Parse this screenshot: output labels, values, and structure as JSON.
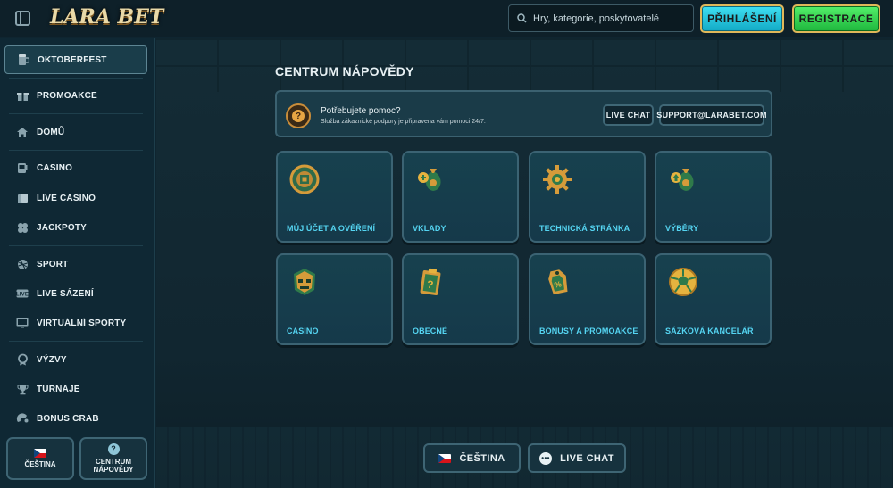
{
  "brand": {
    "logo_text": "LARA BET"
  },
  "header": {
    "search_placeholder": "Hry, kategorie, poskytovatelé",
    "login_label": "PŘIHLÁŠENÍ",
    "register_label": "REGISTRACE"
  },
  "sidebar": {
    "items": [
      {
        "label": "OKTOBERFEST",
        "icon": "beer-icon"
      },
      {
        "label": "PROMOAKCE",
        "icon": "gift-icon"
      },
      {
        "label": "DOMŮ",
        "icon": "home-icon"
      },
      {
        "label": "CASINO",
        "icon": "slot-machine-icon"
      },
      {
        "label": "LIVE CASINO",
        "icon": "cards-icon"
      },
      {
        "label": "JACKPOTY",
        "icon": "clover-icon"
      },
      {
        "label": "SPORT",
        "icon": "ball-icon"
      },
      {
        "label": "LIVE SÁZENÍ",
        "icon": "live-icon"
      },
      {
        "label": "VIRTUÁLNÍ SPORTY",
        "icon": "monitor-icon"
      },
      {
        "label": "VÝZVY",
        "icon": "medal-icon"
      },
      {
        "label": "TURNAJE",
        "icon": "trophy-icon"
      },
      {
        "label": "BONUS CRAB",
        "icon": "crab-icon"
      }
    ],
    "language_label": "ČEŠTINA",
    "help_center_label_1": "CENTRUM",
    "help_center_label_2": "NÁPOVĚDY"
  },
  "main": {
    "title": "CENTRUM NÁPOVĚDY",
    "help_banner": {
      "title": "Potřebujete pomoc?",
      "subtitle": "Služba zákaznické podpory je připravena vám pomoci 24/7.",
      "live_chat_label": "LIVE CHAT",
      "email_label": "SUPPORT@LARABET.COM"
    },
    "categories": [
      {
        "label": "MŮJ ÚČET A OVĚŘENÍ",
        "icon": "account-coin-icon"
      },
      {
        "label": "VKLADY",
        "icon": "deposit-bag-icon"
      },
      {
        "label": "TECHNICKÁ STRÁNKA",
        "icon": "gear-icon"
      },
      {
        "label": "VÝBĚRY",
        "icon": "withdraw-bag-icon"
      },
      {
        "label": "CASINO",
        "icon": "mask-icon"
      },
      {
        "label": "OBECNÉ",
        "icon": "clipboard-icon"
      },
      {
        "label": "BONUSY A PROMOAKCE",
        "icon": "tag-icon"
      },
      {
        "label": "SÁZKOVÁ KANCELÁŘ",
        "icon": "football-icon"
      }
    ],
    "bottom_language_label": "ČEŠTINA",
    "bottom_live_chat_label": "LIVE CHAT"
  },
  "colors": {
    "accent": "#55d5f2",
    "login_button": "#1fbfd8",
    "register_button": "#2fd24c",
    "gold_border": "#e0b85a"
  }
}
